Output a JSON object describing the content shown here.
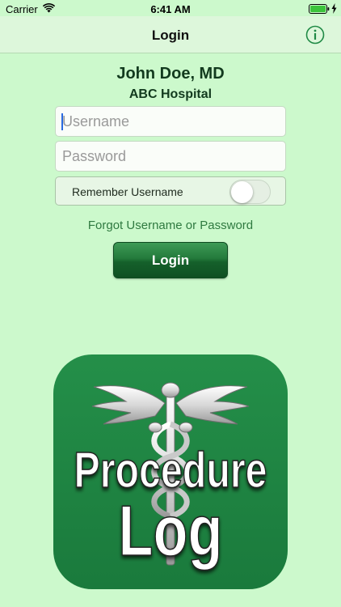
{
  "status_bar": {
    "carrier": "Carrier",
    "time": "6:41 AM",
    "icons": [
      "wifi-icon",
      "battery-icon",
      "charging-bolt-icon"
    ]
  },
  "nav": {
    "title": "Login",
    "info_icon": "info-icon"
  },
  "header": {
    "name": "John Doe, MD",
    "hospital": "ABC Hospital"
  },
  "form": {
    "username_placeholder": "Username",
    "username_value": "",
    "password_placeholder": "Password",
    "password_value": "",
    "remember_label": "Remember Username",
    "remember_on": false,
    "forgot_link": "Forgot Username or Password",
    "login_button": "Login"
  },
  "logo": {
    "line1": "Procedure",
    "line2": "Log",
    "icon": "caduceus-icon"
  },
  "colors": {
    "background": "#ccf9cc",
    "nav_background": "#ddf7db",
    "accent_green": "#1e7a3c",
    "logo_green": "#1f8a45",
    "link_green": "#2f7a40"
  }
}
